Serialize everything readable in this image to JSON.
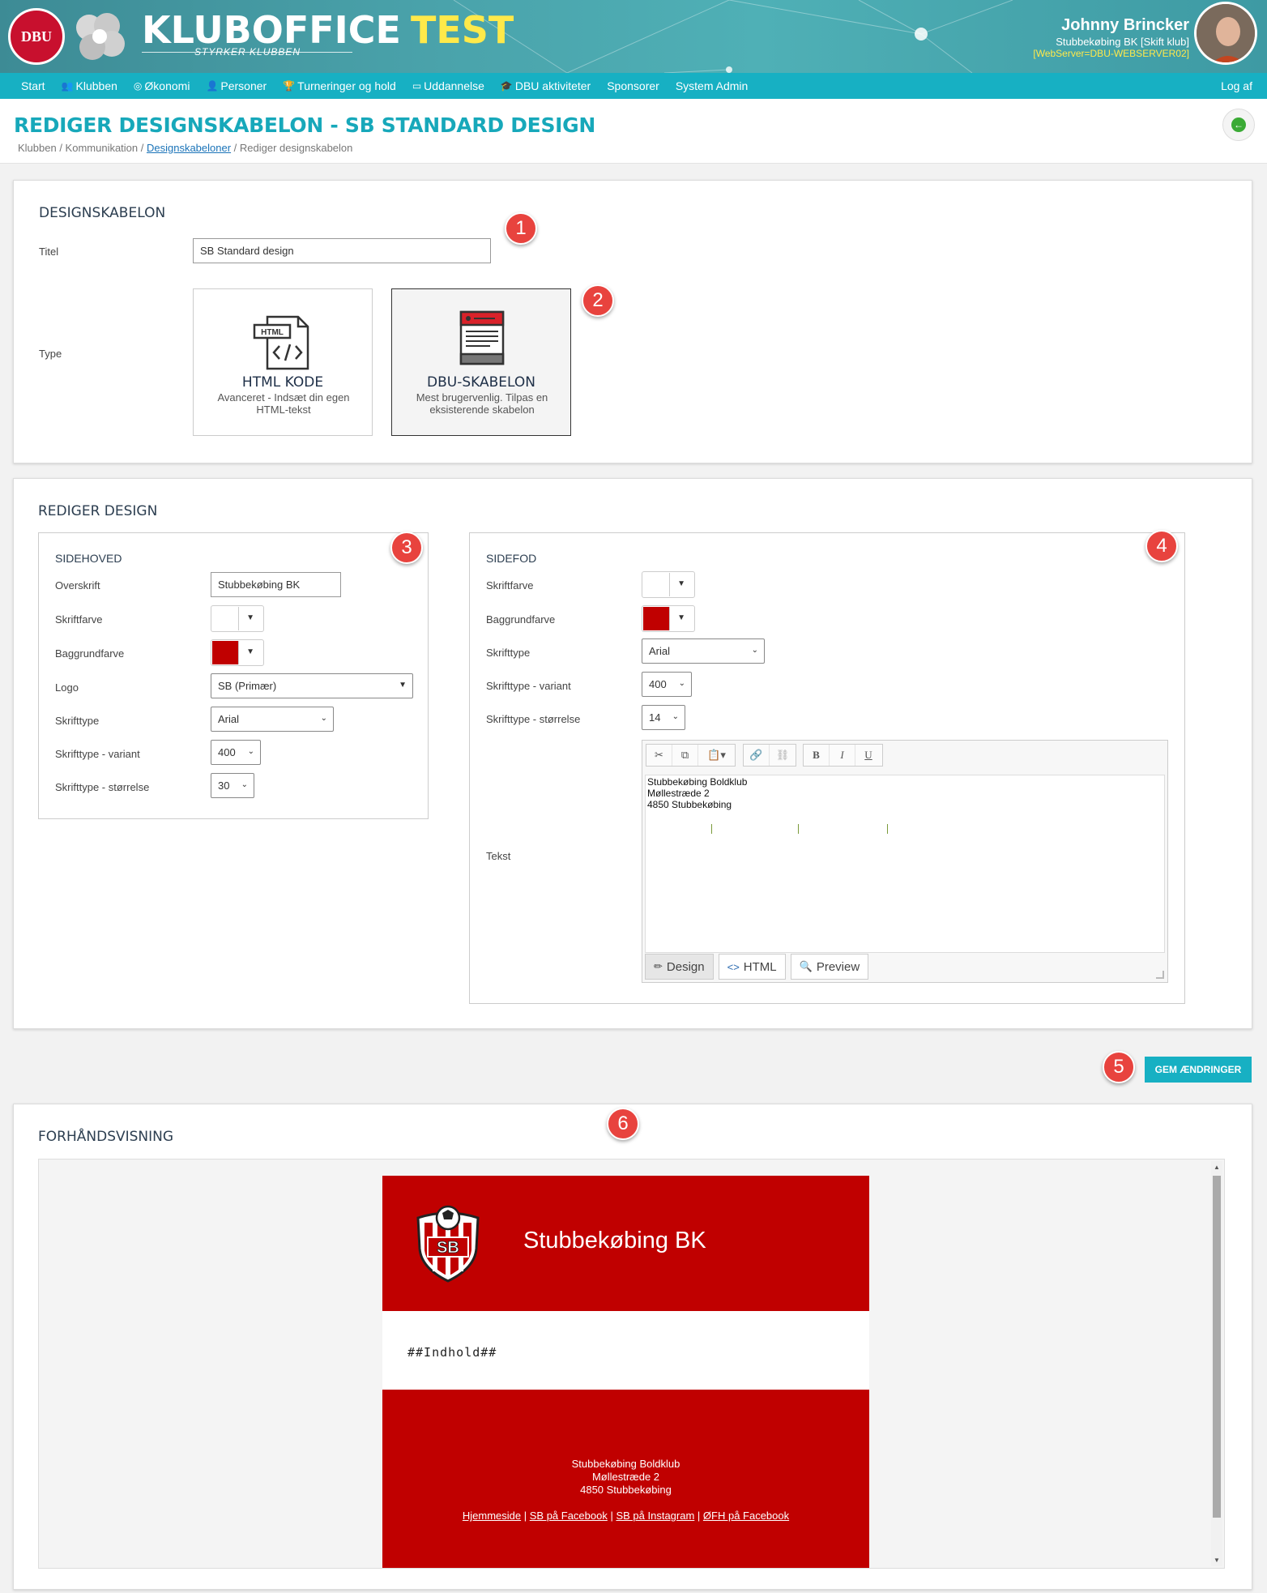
{
  "app": {
    "brand": "KLUBOFFICE",
    "brand_env": "TEST",
    "tagline": "STYRKER KLUBBEN",
    "dbu_logo_text": "DBU"
  },
  "user": {
    "name": "Johnny Brincker",
    "club": "Stubbekøbing BK [Skift klub]",
    "server": "[WebServer=DBU-WEBSERVER02]"
  },
  "nav": {
    "items": [
      "Start",
      "Klubben",
      "Økonomi",
      "Personer",
      "Turneringer og hold",
      "Uddannelse",
      "DBU aktiviteter",
      "Sponsorer",
      "System Admin"
    ],
    "logout": "Log af"
  },
  "page": {
    "title": "REDIGER DESIGNSKABELON - SB STANDARD DESIGN",
    "breadcrumb": {
      "part1": "Klubben / Kommunikation / ",
      "link": "Designskabeloner",
      "part2": " / Rediger designskabelon"
    }
  },
  "designskabelon": {
    "heading": "DESIGNSKABELON",
    "title_label": "Titel",
    "title_value": "SB Standard design",
    "type_label": "Type",
    "types": [
      {
        "title": "HTML KODE",
        "desc": "Avanceret - Indsæt din egen HTML-tekst",
        "icon_tag": "HTML"
      },
      {
        "title": "DBU-SKABELON",
        "desc": "Mest brugervenlig. Tilpas en eksisterende skabelon"
      }
    ]
  },
  "edit": {
    "heading": "REDIGER DESIGN",
    "header": {
      "heading": "SIDEHOVED",
      "labels": {
        "headline": "Overskrift",
        "font_color": "Skriftfarve",
        "bg_color": "Baggrundfarve",
        "logo": "Logo",
        "font": "Skrifttype",
        "variant": "Skrifttype - variant",
        "size": "Skrifttype - størrelse"
      },
      "values": {
        "headline": "Stubbekøbing BK",
        "font_color": "#ffffff",
        "bg_color": "#c00000",
        "logo": "SB (Primær)",
        "font": "Arial",
        "variant": "400",
        "size": "30"
      }
    },
    "footer": {
      "heading": "SIDEFOD",
      "labels": {
        "font_color": "Skriftfarve",
        "bg_color": "Baggrundfarve",
        "font": "Skrifttype",
        "variant": "Skrifttype - variant",
        "size": "Skrifttype - størrelse",
        "text": "Tekst"
      },
      "values": {
        "font_color": "#ffffff",
        "bg_color": "#c00000",
        "font": "Arial",
        "variant": "400",
        "size": "14"
      },
      "editor": {
        "lines": [
          "Stubbekøbing Boldklub",
          "Møllestræde 2",
          "4850 Stubbekøbing"
        ],
        "tabs": [
          "Design",
          "HTML",
          "Preview"
        ]
      }
    }
  },
  "save_button": "GEM ÆNDRINGER",
  "preview": {
    "heading": "FORHÅNDSVISNING",
    "header_title": "Stubbekøbing BK",
    "logo_text": "SB",
    "body_placeholder": "##Indhold##",
    "footer_lines": [
      "Stubbekøbing Boldklub",
      "Møllestræde 2",
      "4850 Stubbekøbing"
    ],
    "links": [
      "Hjemmeside",
      "SB på Facebook",
      "SB på Instagram",
      "ØFH på Facebook"
    ],
    "link_sep": " | "
  },
  "markers": [
    "1",
    "2",
    "3",
    "4",
    "5",
    "6"
  ],
  "colors": {
    "accent": "#17b0c3",
    "marker": "#e8433e",
    "brand_red": "#c00000"
  }
}
